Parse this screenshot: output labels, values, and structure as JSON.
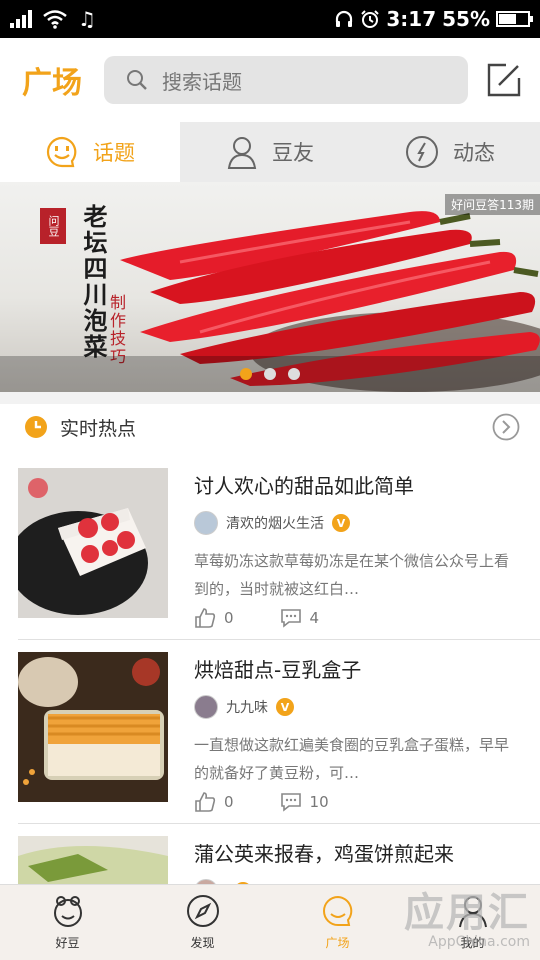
{
  "status_bar": {
    "time": "3:17",
    "battery": "55%"
  },
  "header": {
    "title": "广场",
    "search_placeholder": "搜索话题"
  },
  "tabs": [
    {
      "label": "话题",
      "icon": "smile-chat-icon",
      "active": true
    },
    {
      "label": "豆友",
      "icon": "person-icon",
      "active": false
    },
    {
      "label": "动态",
      "icon": "compass-icon",
      "active": false
    }
  ],
  "banner": {
    "tag": "好问豆答113期",
    "seal": "问豆",
    "title": "老坛四川泡菜",
    "subtitle": "制作技巧",
    "page_count": 3,
    "active_page": 1
  },
  "hot": {
    "title": "实时热点"
  },
  "feed": [
    {
      "title": "讨人欢心的甜品如此简单",
      "author": "清欢的烟火生活",
      "verified": true,
      "desc": "草莓奶冻这款草莓奶冻是在某个微信公众号上看到的，当时就被这红白…",
      "likes": "0",
      "comments": "4"
    },
    {
      "title": "烘焙甜点-豆乳盒子",
      "author": "九九味",
      "verified": true,
      "desc": "一直想做这款红遍美食圈的豆乳盒子蛋糕，早早的就备好了黄豆粉，可…",
      "likes": "0",
      "comments": "10"
    },
    {
      "title": "蒲公英来报春，鸡蛋饼煎起来",
      "author": "",
      "verified": true,
      "desc": "",
      "likes": "",
      "comments": ""
    }
  ],
  "bottom_nav": [
    {
      "label": "好豆",
      "icon": "haodou-face-icon",
      "active": false
    },
    {
      "label": "发现",
      "icon": "compass-icon",
      "active": false
    },
    {
      "label": "广场",
      "icon": "square-icon",
      "active": true
    },
    {
      "label": "我的",
      "icon": "user-icon",
      "active": false
    }
  ],
  "watermark": {
    "main": "应用汇",
    "sub": "AppChina.com"
  },
  "colors": {
    "accent": "#f2a31a",
    "tab_bg": "#ebebeb",
    "search_bg": "#e4e4e4"
  }
}
